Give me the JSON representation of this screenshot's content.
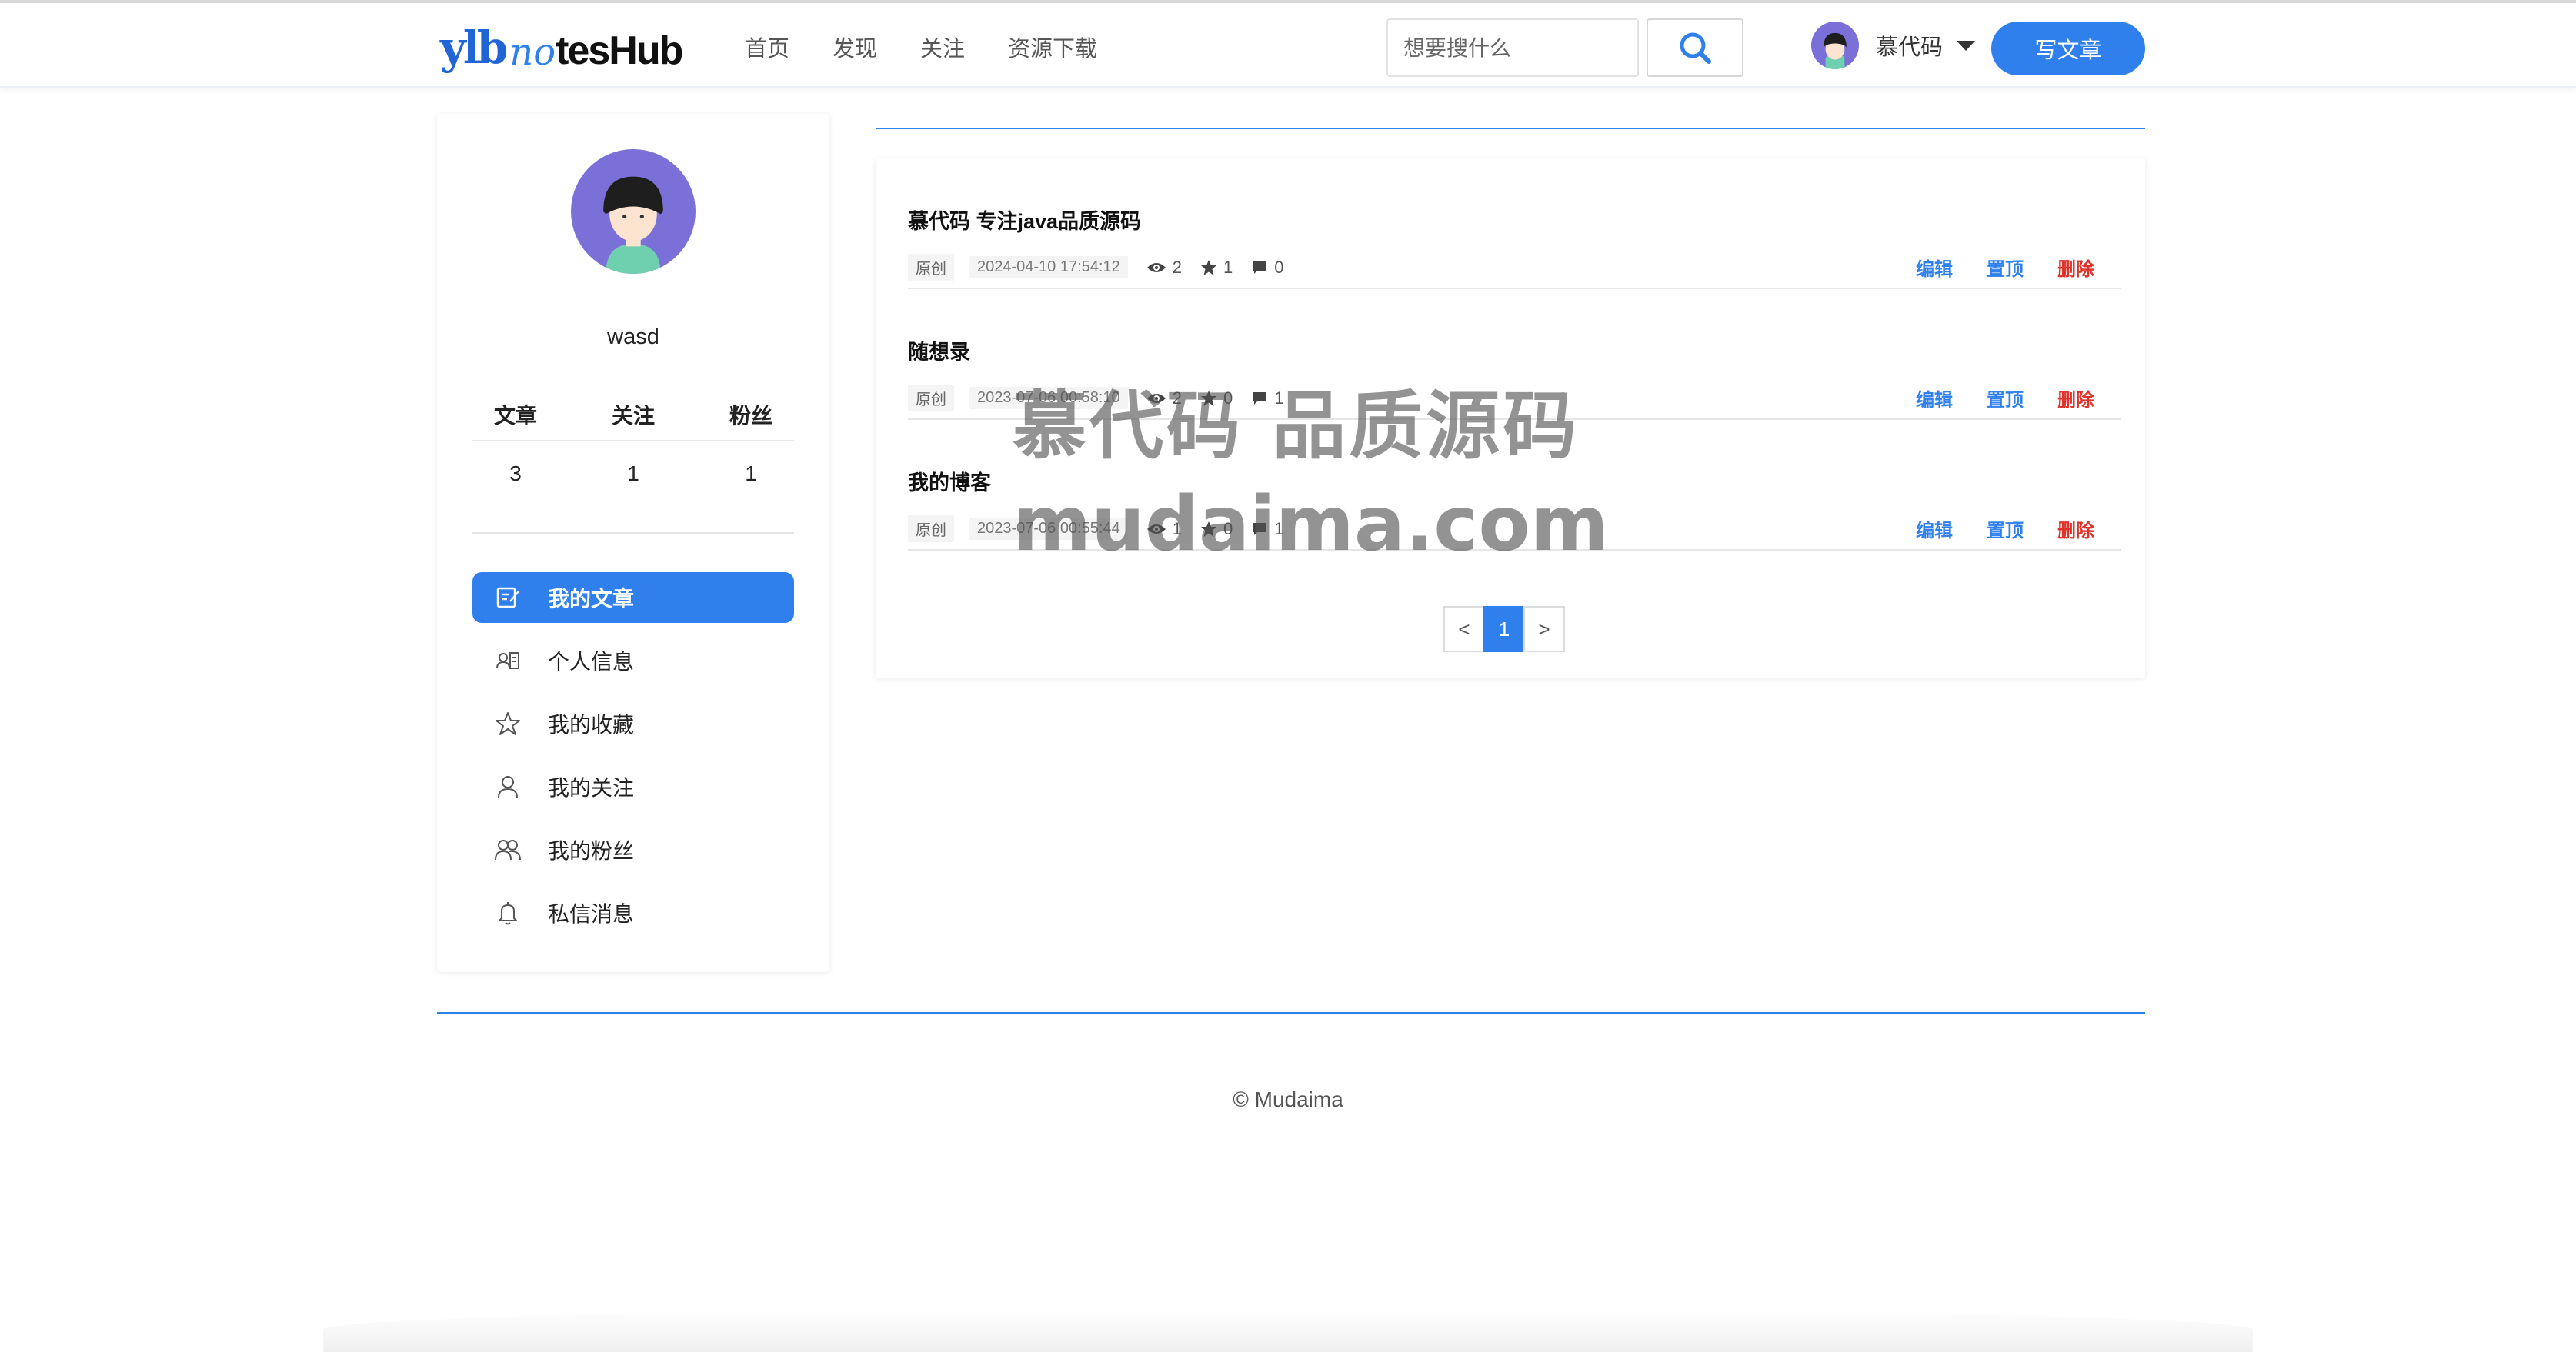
{
  "header": {
    "logo": {
      "part1": "ylb",
      "part2": "no",
      "part3": "tesHub"
    },
    "nav": [
      "首页",
      "发现",
      "关注",
      "资源下载"
    ],
    "search_placeholder": "想要搜什么",
    "user_name": "慕代码",
    "write_label": "写文章"
  },
  "profile": {
    "name": "wasd",
    "stats_labels": [
      "文章",
      "关注",
      "粉丝"
    ],
    "stats_values": [
      "3",
      "1",
      "1"
    ]
  },
  "sidebar": {
    "items": [
      {
        "label": "我的文章",
        "icon": "edit-icon",
        "active": true
      },
      {
        "label": "个人信息",
        "icon": "id-card-icon",
        "active": false
      },
      {
        "label": "我的收藏",
        "icon": "star-icon",
        "active": false
      },
      {
        "label": "我的关注",
        "icon": "user-icon",
        "active": false
      },
      {
        "label": "我的粉丝",
        "icon": "users-icon",
        "active": false
      },
      {
        "label": "私信消息",
        "icon": "bell-icon",
        "active": false
      }
    ]
  },
  "articles": [
    {
      "title": "慕代码 专注java品质源码",
      "tag": "原创",
      "date": "2024-04-10 17:54:12",
      "views": "2",
      "stars": "1",
      "comments": "0"
    },
    {
      "title": "随想录",
      "tag": "原创",
      "date": "2023-07-06 00:58:10",
      "views": "2",
      "stars": "0",
      "comments": "1"
    },
    {
      "title": "我的博客",
      "tag": "原创",
      "date": "2023-07-06 00:55:44",
      "views": "1",
      "stars": "0",
      "comments": "1"
    }
  ],
  "article_actions": {
    "edit": "编辑",
    "pin": "置顶",
    "delete": "删除"
  },
  "pagination": {
    "prev": "<",
    "current": "1",
    "next": ">"
  },
  "footer": {
    "copyright": "© Mudaima"
  },
  "watermark": {
    "line1": "慕代码 品质源码",
    "line2": "mudaima.com"
  },
  "colors": {
    "accent": "#2f80ed",
    "danger": "#e0322b",
    "avatar_bg": "#7b6fd8"
  }
}
